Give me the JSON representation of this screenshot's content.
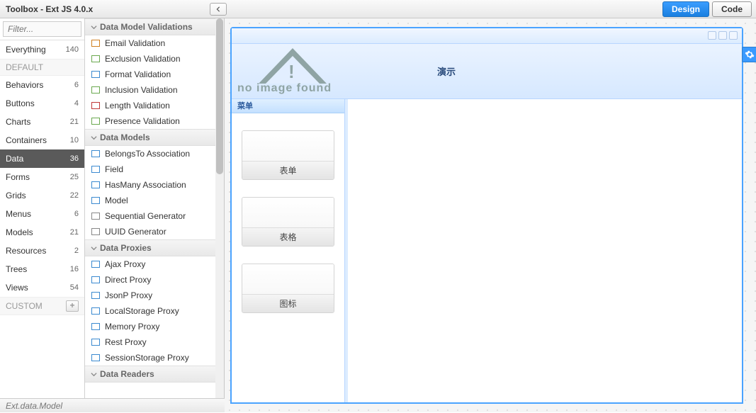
{
  "topbar": {
    "title": "Toolbox - Ext JS 4.0.x"
  },
  "modes": {
    "design": "Design",
    "code": "Code",
    "active": "design"
  },
  "filter_placeholder": "Filter...",
  "category_groups": {
    "default_label": "DEFAULT",
    "custom_label": "CUSTOM"
  },
  "categories": [
    {
      "name": "Everything",
      "count": 140
    },
    {
      "name": "Behaviors",
      "count": 6
    },
    {
      "name": "Buttons",
      "count": 4
    },
    {
      "name": "Charts",
      "count": 21
    },
    {
      "name": "Containers",
      "count": 10
    },
    {
      "name": "Data",
      "count": 36,
      "selected": true
    },
    {
      "name": "Forms",
      "count": 25
    },
    {
      "name": "Grids",
      "count": 22
    },
    {
      "name": "Menus",
      "count": 6
    },
    {
      "name": "Models",
      "count": 21
    },
    {
      "name": "Resources",
      "count": 2
    },
    {
      "name": "Trees",
      "count": 16
    },
    {
      "name": "Views",
      "count": 54
    }
  ],
  "item_groups": [
    {
      "title": "Data Model Validations",
      "items": [
        {
          "label": "Email Validation",
          "color": "#d08020"
        },
        {
          "label": "Exclusion Validation",
          "color": "#6aa84f"
        },
        {
          "label": "Format Validation",
          "color": "#3b8ad0"
        },
        {
          "label": "Inclusion Validation",
          "color": "#6aa84f"
        },
        {
          "label": "Length Validation",
          "color": "#c03838"
        },
        {
          "label": "Presence Validation",
          "color": "#6aa84f"
        }
      ]
    },
    {
      "title": "Data Models",
      "items": [
        {
          "label": "BelongsTo Association",
          "color": "#3b8ad0"
        },
        {
          "label": "Field",
          "color": "#3b8ad0"
        },
        {
          "label": "HasMany Association",
          "color": "#3b8ad0"
        },
        {
          "label": "Model",
          "color": "#3b8ad0"
        },
        {
          "label": "Sequential Generator",
          "color": "#888"
        },
        {
          "label": "UUID Generator",
          "color": "#888"
        }
      ]
    },
    {
      "title": "Data Proxies",
      "items": [
        {
          "label": "Ajax Proxy",
          "color": "#3b8ad0"
        },
        {
          "label": "Direct Proxy",
          "color": "#3b8ad0"
        },
        {
          "label": "JsonP Proxy",
          "color": "#3b8ad0"
        },
        {
          "label": "LocalStorage Proxy",
          "color": "#3b8ad0"
        },
        {
          "label": "Memory Proxy",
          "color": "#3b8ad0"
        },
        {
          "label": "Rest Proxy",
          "color": "#3b8ad0"
        },
        {
          "label": "SessionStorage Proxy",
          "color": "#3b8ad0"
        }
      ]
    },
    {
      "title": "Data Readers",
      "items": []
    }
  ],
  "canvas": {
    "no_image_text": "no image found",
    "demo_title": "演示",
    "menu_title": "菜单",
    "cards": [
      {
        "label": "表单"
      },
      {
        "label": "表格"
      },
      {
        "label": "图标"
      }
    ]
  },
  "status_text": "Ext.data.Model"
}
